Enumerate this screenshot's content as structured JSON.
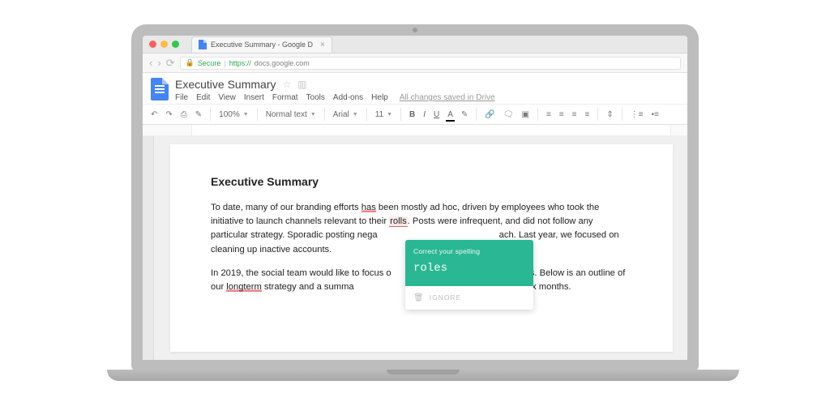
{
  "browser": {
    "tab_title": "Executive Summary - Google D",
    "secure_label": "Secure",
    "url_protocol": "https://",
    "url_host": "docs.google.com"
  },
  "docs": {
    "title": "Executive Summary",
    "menus": [
      "File",
      "Edit",
      "View",
      "Insert",
      "Format",
      "Tools",
      "Add-ons",
      "Help"
    ],
    "save_status": "All changes saved in Drive",
    "toolbar": {
      "zoom": "100%",
      "style": "Normal text",
      "font": "Arial",
      "size": "11"
    }
  },
  "document": {
    "heading": "Executive Summary",
    "p1_a": "To date, many of our branding efforts ",
    "p1_err1": "has",
    "p1_b": " been mostly ad hoc, driven by employees who took the initiative to launch channels relevant to their ",
    "p1_err2": "rolls",
    "p1_c": ". Posts were infrequent, and did not follow any particular strategy. Sporadic posting nega",
    "p1_gap1": "",
    "p1_d": "ach. Last year, we focused on cleaning up inactive accounts.",
    "p2_a": "In 2019, the social team would like to focus o",
    "p2_gap1": "",
    "p2_b": "nnels. Below is an outline of our ",
    "p2_err1": "longterm",
    "p2_c": " strategy and a summa",
    "p2_gap2": "",
    "p2_d": "mplete in the next six months."
  },
  "popup": {
    "hint": "Correct your spelling",
    "suggestion": "roles",
    "ignore": "IGNORE"
  }
}
